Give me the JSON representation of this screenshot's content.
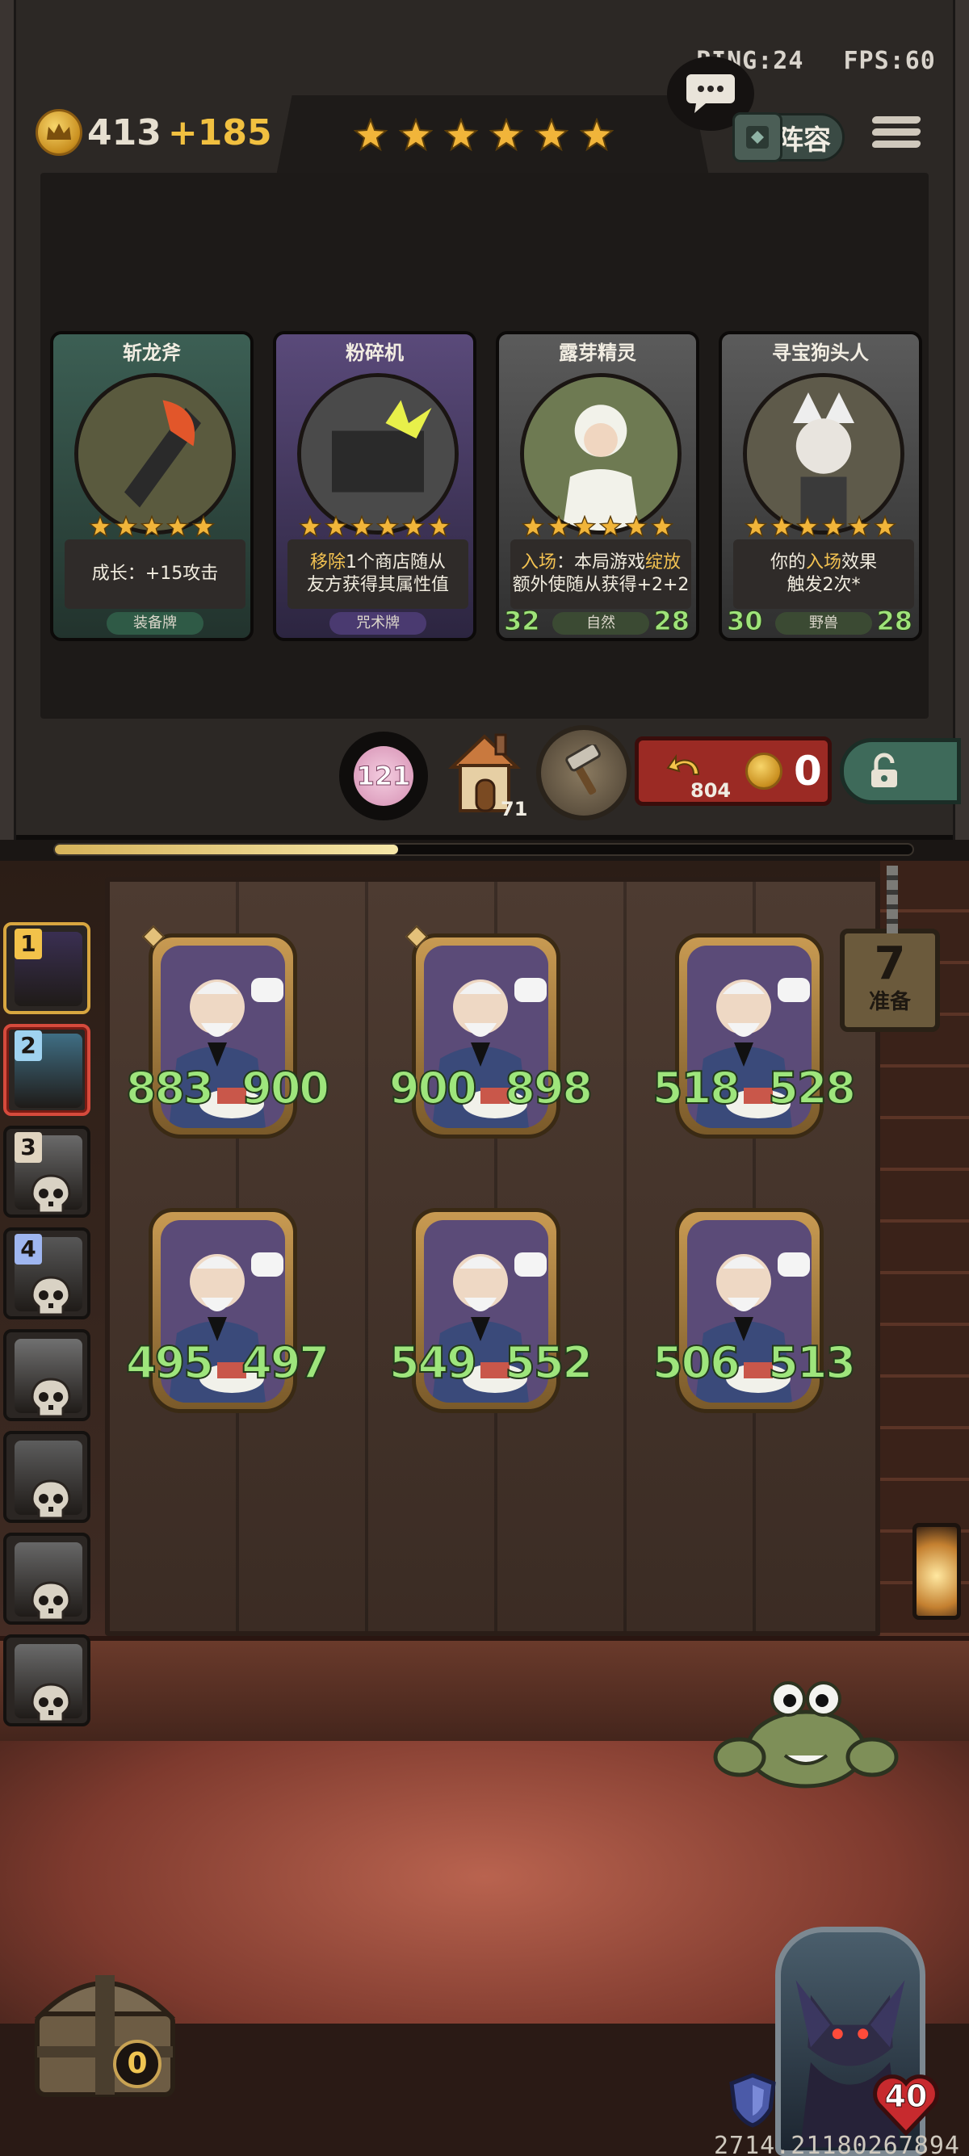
{
  "net": {
    "ping": "PING:24",
    "fps": "FPS:60"
  },
  "gold": {
    "amount": "413",
    "income": "+185"
  },
  "tavern_stars": 6,
  "lineup_label": "阵容",
  "shop_cards": [
    {
      "title": "斩龙斧",
      "stars": 5,
      "desc_lines": [
        [
          {
            "t": "成长："
          },
          {
            "t": "+15攻击"
          }
        ]
      ],
      "type": "装备牌",
      "theme": "green",
      "atk": "",
      "hp": ""
    },
    {
      "title": "粉碎机",
      "stars": 6,
      "desc_lines": [
        [
          {
            "t": "移除",
            "hl": true
          },
          {
            "t": "1个商店随从"
          }
        ],
        [
          {
            "t": "友方获得其属性值"
          }
        ]
      ],
      "type": "咒术牌",
      "theme": "purple",
      "atk": "",
      "hp": ""
    },
    {
      "title": "露芽精灵",
      "stars": 6,
      "desc_lines": [
        [
          {
            "t": "入场",
            "hl": true
          },
          {
            "t": "：本局游戏"
          },
          {
            "t": "绽放",
            "hl": true
          }
        ],
        [
          {
            "t": "额外使随从获得+2+2"
          }
        ]
      ],
      "type": "自然",
      "theme": "gray",
      "atk": "32",
      "hp": "28"
    },
    {
      "title": "寻宝狗头人",
      "stars": 6,
      "desc_lines": [
        [
          {
            "t": "你的"
          },
          {
            "t": "入场",
            "hl": true
          },
          {
            "t": "效果"
          }
        ],
        [
          {
            "t": "触发2次*"
          }
        ]
      ],
      "type": "野兽",
      "theme": "gray",
      "atk": "30",
      "hp": "28"
    }
  ],
  "controls": {
    "refresh_count": "121",
    "house_count": "71",
    "reroll_remaining": "804",
    "reroll_cost": "0"
  },
  "xp_progress": 0.4,
  "tiers": [
    {
      "num": "1",
      "state": "current",
      "eliminated": false,
      "num_color": "#f2c24a"
    },
    {
      "num": "2",
      "state": "active",
      "eliminated": false,
      "num_color": "#9fd2f0"
    },
    {
      "num": "3",
      "state": "",
      "eliminated": true,
      "num_color": "#e0d4c0"
    },
    {
      "num": "4",
      "state": "",
      "eliminated": true,
      "num_color": "#9fb6f0"
    },
    {
      "num": "",
      "state": "",
      "eliminated": true,
      "num_color": ""
    },
    {
      "num": "",
      "state": "",
      "eliminated": true,
      "num_color": ""
    },
    {
      "num": "",
      "state": "",
      "eliminated": true,
      "num_color": ""
    },
    {
      "num": "",
      "state": "",
      "eliminated": true,
      "num_color": ""
    }
  ],
  "prep": {
    "count": "7",
    "label": "准备"
  },
  "minions": [
    {
      "atk": "883",
      "hp": "900",
      "golden": true
    },
    {
      "atk": "900",
      "hp": "898",
      "golden": true
    },
    {
      "atk": "518",
      "hp": "528",
      "golden": false
    },
    {
      "atk": "495",
      "hp": "497",
      "golden": false
    },
    {
      "atk": "549",
      "hp": "552",
      "golden": false
    },
    {
      "atk": "506",
      "hp": "513",
      "golden": false
    }
  ],
  "chest_count": "0",
  "hero": {
    "hp": "40"
  },
  "build_id": "2714.21180267894",
  "colors": {
    "accent_gold": "#f1c040",
    "stat_green": "#9ee57c",
    "reroll_red": "#9b2a24",
    "lock_teal": "#3e6a5a"
  }
}
